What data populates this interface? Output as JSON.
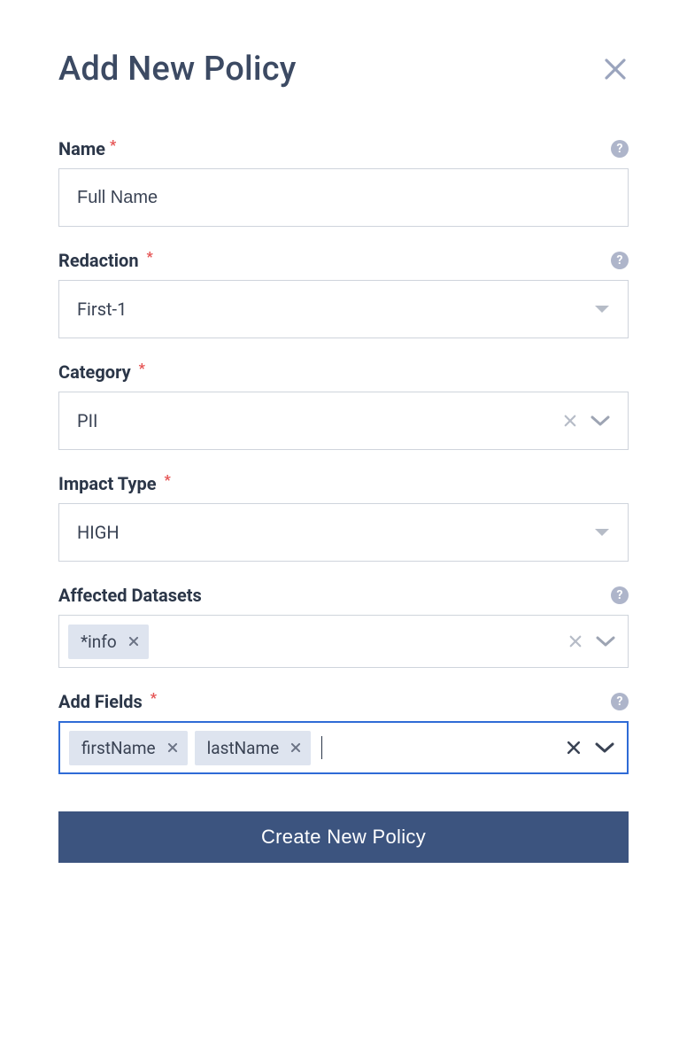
{
  "modal": {
    "title": "Add New Policy"
  },
  "fields": {
    "name": {
      "label": "Name",
      "required": true,
      "value": "Full Name",
      "has_help": true
    },
    "redaction": {
      "label": "Redaction",
      "required": true,
      "value": "First-1",
      "has_help": true
    },
    "category": {
      "label": "Category",
      "required": true,
      "value": "PII",
      "has_help": false,
      "clearable": true
    },
    "impact_type": {
      "label": "Impact Type",
      "required": true,
      "value": "HIGH",
      "has_help": false
    },
    "affected_datasets": {
      "label": "Affected Datasets",
      "required": false,
      "has_help": true,
      "tags": [
        "*info"
      ],
      "clearable": true
    },
    "add_fields": {
      "label": "Add Fields",
      "required": true,
      "has_help": true,
      "tags": [
        "firstName",
        "lastName"
      ],
      "clearable": true,
      "focused": true
    }
  },
  "submit": {
    "label": "Create New Policy"
  },
  "help_glyph": "?"
}
